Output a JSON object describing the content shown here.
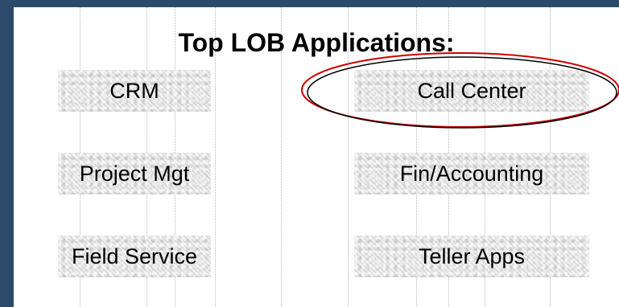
{
  "title": "Top LOB Applications:",
  "applications": [
    {
      "label": "CRM"
    },
    {
      "label": "Call Center",
      "highlighted": true
    },
    {
      "label": "Project Mgt"
    },
    {
      "label": "Fin/Accounting"
    },
    {
      "label": "Field Service"
    },
    {
      "label": "Teller Apps"
    }
  ],
  "colors": {
    "frame": "#2c4a6b",
    "highlight_outer": "#cc0000",
    "highlight_inner": "#000000"
  }
}
